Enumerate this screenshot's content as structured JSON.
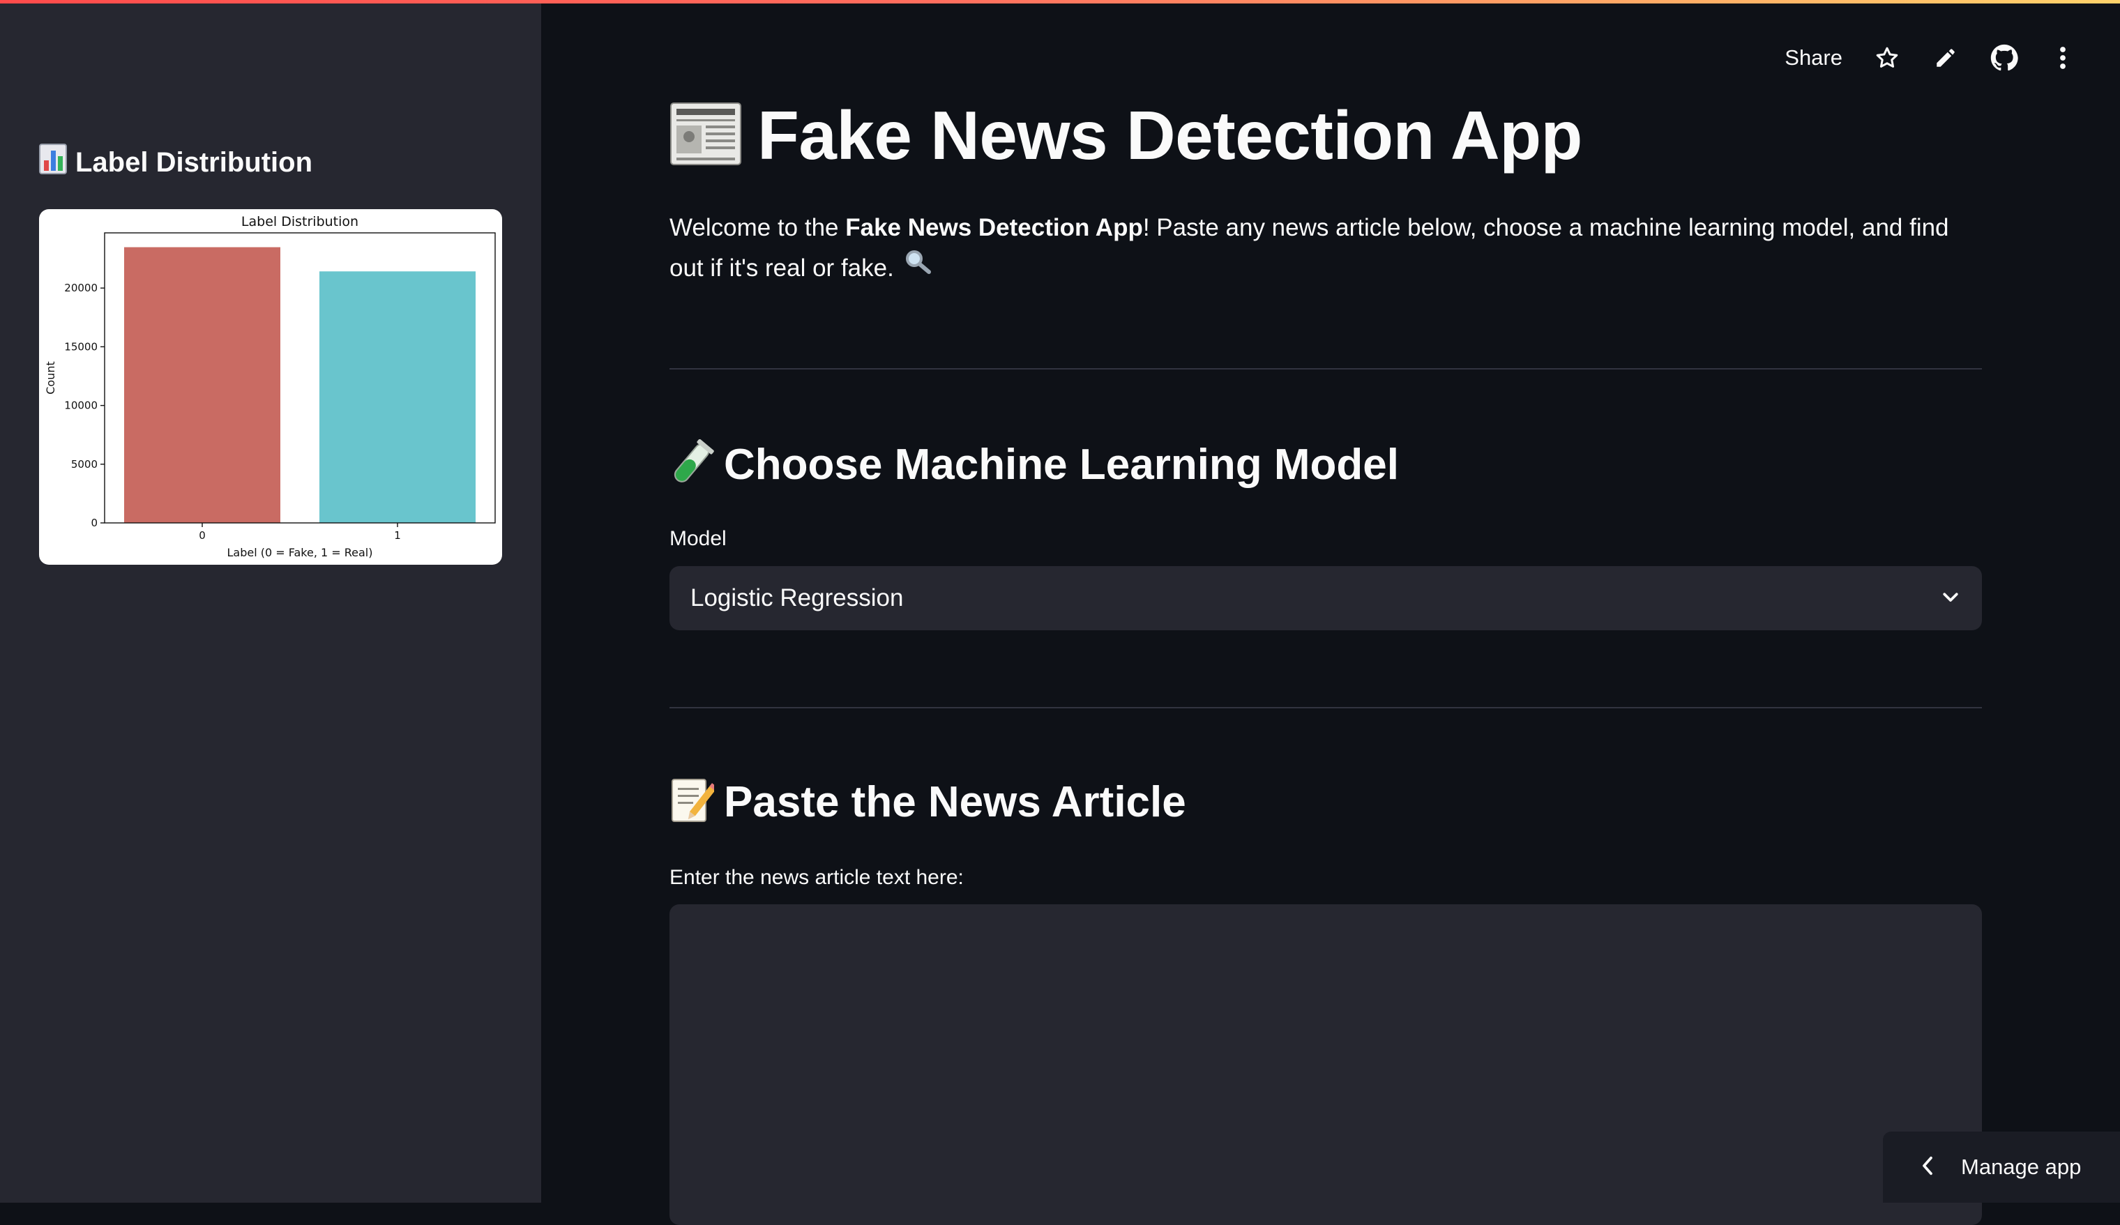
{
  "sidebar": {
    "title_icon": "bar-chart-emoji",
    "title": "Label Distribution",
    "chart": {
      "title": "Label Distribution",
      "xlabel": "Label (0 = Fake, 1 = Real)",
      "ylabel": "Count"
    }
  },
  "toolbar": {
    "share_label": "Share",
    "icons": [
      "star-icon",
      "pencil-icon",
      "github-icon",
      "more-vertical-icon"
    ]
  },
  "main": {
    "title_icon": "newspaper-emoji",
    "title": "Fake News Detection App",
    "intro": {
      "before": "Welcome to the ",
      "bold": "Fake News Detection App",
      "after": "! Paste any news article below, choose a machine learning model, and find out if it's real or fake.",
      "trailing_icon": "magnifying-glass-emoji"
    },
    "model_section": {
      "icon": "test-tube-emoji",
      "title": "Choose Machine Learning Model",
      "label": "Model",
      "selected": "Logistic Regression"
    },
    "article_section": {
      "icon": "memo-emoji",
      "title": "Paste the News Article",
      "label": "Enter the news article text here:",
      "value": ""
    }
  },
  "manage_app": {
    "label": "Manage app"
  },
  "colors": {
    "background": "#0e1117",
    "sidebar": "#262730",
    "input": "#262730",
    "bar_fake": "#c96b63",
    "bar_real": "#69c5cd"
  },
  "chart_data": {
    "type": "bar",
    "title": "Label Distribution",
    "xlabel": "Label (0 = Fake, 1 = Real)",
    "ylabel": "Count",
    "categories": [
      "0",
      "1"
    ],
    "values": [
      23480,
      21420
    ],
    "colors": [
      "#c96b63",
      "#69c5cd"
    ],
    "ylim": [
      0,
      24700
    ],
    "yticks": [
      0,
      5000,
      10000,
      15000,
      20000
    ],
    "grid": false
  }
}
